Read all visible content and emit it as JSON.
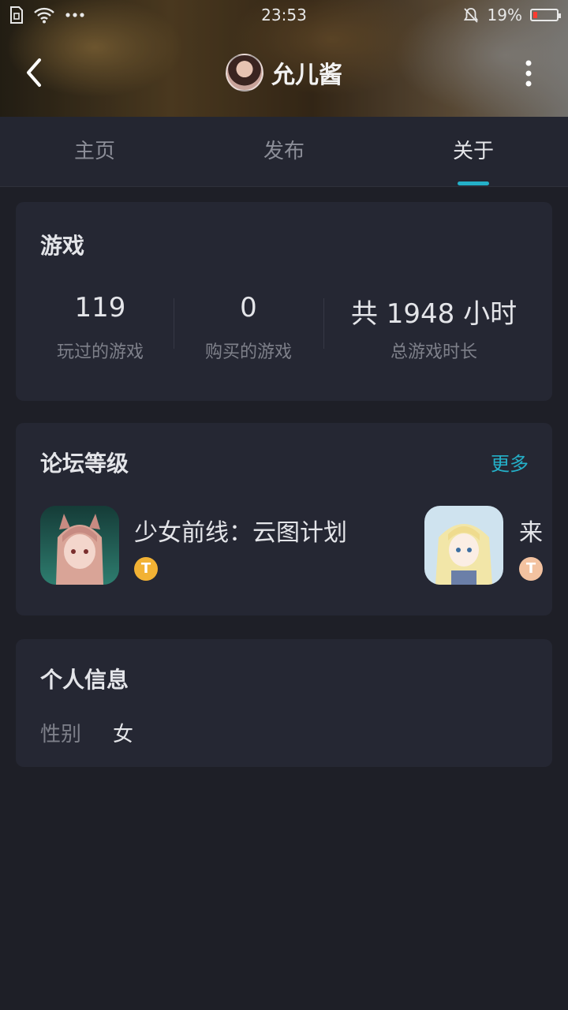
{
  "status_bar": {
    "time": "23:53",
    "battery_percent": "19%",
    "battery_level": 0.19
  },
  "header": {
    "title": "允儿酱"
  },
  "tabs": [
    {
      "label": "主页",
      "active": false
    },
    {
      "label": "发布",
      "active": false
    },
    {
      "label": "关于",
      "active": true
    }
  ],
  "games": {
    "title": "游戏",
    "stats": [
      {
        "value": "119",
        "label": "玩过的游戏"
      },
      {
        "value": "0",
        "label": "购买的游戏"
      },
      {
        "value": "共 1948 小时",
        "label": "总游戏时长"
      }
    ]
  },
  "forum": {
    "title": "论坛等级",
    "more_label": "更多",
    "items": [
      {
        "name": "少女前线：云图计划",
        "badge": "T"
      },
      {
        "name": "来",
        "badge": "T"
      }
    ]
  },
  "personal": {
    "title": "个人信息",
    "fields": [
      {
        "key": "性别",
        "value": "女"
      }
    ]
  },
  "colors": {
    "accent": "#24b0c8",
    "background": "#1e1f27",
    "card": "#252733"
  }
}
